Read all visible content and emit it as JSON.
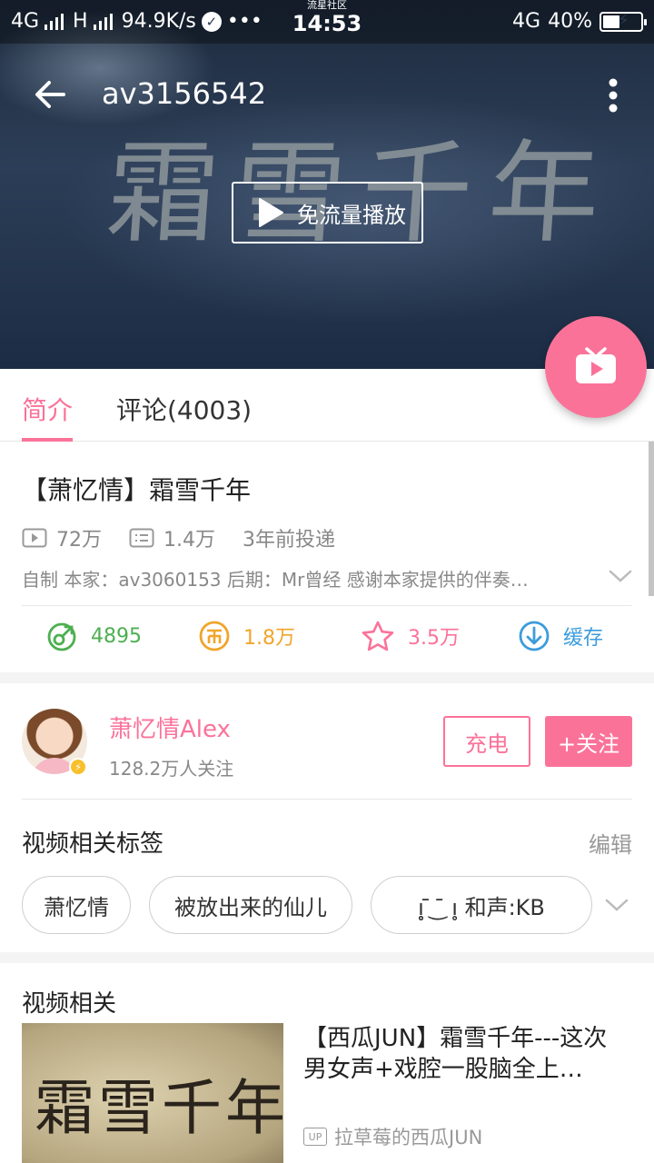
{
  "status_bar": {
    "left_network": "4G",
    "left_network2": "H",
    "speed": "94.9K/s",
    "more": "•••",
    "carrier_label": "流星社区",
    "time": "14:53",
    "right_network": "4G",
    "battery_percent": "40%"
  },
  "video": {
    "id_title": "av3156542",
    "background_calligraphy": "霜雪千年",
    "play_free_label": "免流量播放"
  },
  "tabs": {
    "intro": "简介",
    "comments": "评论(4003)"
  },
  "info": {
    "title": "【萧忆情】霜雪千年",
    "views": "72万",
    "danmaku": "1.4万",
    "posted": "3年前投递",
    "description": "自制 本家：av3060153 后期：Mr曾经 感谢本家提供的伴奏…",
    "actions": {
      "like": "4895",
      "coin": "1.8万",
      "favorite": "3.5万",
      "cache": "缓存"
    }
  },
  "uploader": {
    "name": "萧忆情Alex",
    "followers": "128.2万人关注",
    "charge_label": "充电",
    "follow_label": "+关注"
  },
  "tags": {
    "title": "视频相关标签",
    "edit_label": "编辑",
    "items": [
      "萧忆情",
      "被放出来的仙儿",
      "ı̥̥ ̄ ͜ ̄ ı̥ 和声:KB"
    ]
  },
  "related": {
    "title": "视频相关",
    "thumb_text": "霜雪千年",
    "video_title": "【西瓜JUN】霜雪千年---这次男女声+戏腔一股脑全上…",
    "up_badge": "UP",
    "uploader": "拉草莓的西瓜JUN"
  },
  "colors": {
    "accent": "#fb7299",
    "like": "#4caf50",
    "coin": "#f1a52c",
    "cache": "#3c9cdc"
  }
}
